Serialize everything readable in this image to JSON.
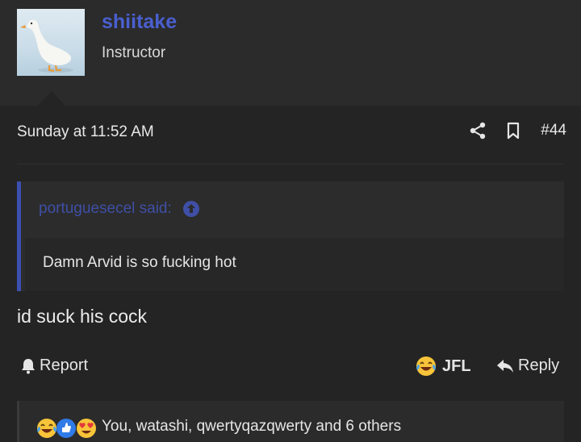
{
  "user": {
    "name": "shiitake",
    "title": "Instructor"
  },
  "post": {
    "date": "Sunday at 11:52 AM",
    "number": "#44",
    "quote": {
      "author": "portuguesecel said:",
      "text": "Damn Arvid is so fucking hot"
    },
    "text": "id suck his cock"
  },
  "actions": {
    "report": "Report",
    "reaction": "JFL",
    "reply": "Reply"
  },
  "reactions": {
    "summary": "You, watashi, qwertyqazqwerty and 6 others"
  },
  "colors": {
    "username": "#4a5fd0",
    "quote_accent": "#3d4fb0",
    "background": "#242424"
  },
  "icons": [
    "share-icon",
    "bookmark-icon",
    "arrow-up-circle-icon",
    "bell-icon",
    "crying-laughing-emoji-icon",
    "reply-arrow-icon",
    "thumbs-up-icon",
    "heart-eyes-emoji-icon"
  ]
}
